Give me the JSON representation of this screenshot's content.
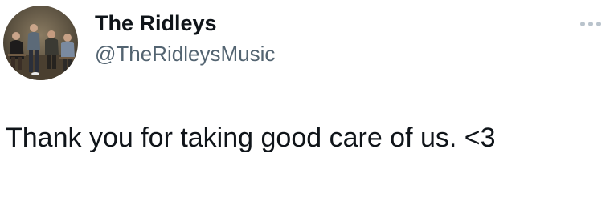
{
  "tweet": {
    "author": {
      "display_name": "The Ridleys",
      "handle": "@TheRidleysMusic",
      "avatar_icon": "band-photo-avatar"
    },
    "more_icon": "more-options-icon",
    "text": "Thank you for taking good care of us. <3"
  },
  "colors": {
    "text_primary": "#0f1419",
    "text_secondary": "#536471",
    "more_icon": "#b9c3cc",
    "background": "#ffffff"
  }
}
